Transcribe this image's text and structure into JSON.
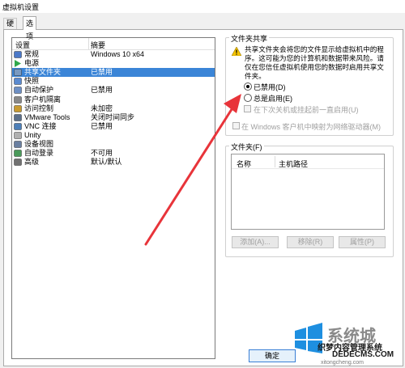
{
  "window": {
    "title": "虚拟机设置"
  },
  "tabs": [
    {
      "label": "硬件",
      "active": false
    },
    {
      "label": "选项",
      "active": true
    }
  ],
  "settings_list": {
    "col_setting": "设置",
    "col_summary": "摘要",
    "items": [
      {
        "name": "常规",
        "summary": "Windows 10 x64",
        "icon": "general-icon",
        "selected": false
      },
      {
        "name": "电源",
        "summary": "",
        "icon": "power-icon",
        "selected": false
      },
      {
        "name": "共享文件夹",
        "summary": "已禁用",
        "icon": "shared-folder-icon",
        "selected": true
      },
      {
        "name": "快照",
        "summary": "",
        "icon": "snapshot-icon",
        "selected": false
      },
      {
        "name": "自动保护",
        "summary": "已禁用",
        "icon": "autoprotect-icon",
        "selected": false
      },
      {
        "name": "客户机隔离",
        "summary": "",
        "icon": "isolation-icon",
        "selected": false
      },
      {
        "name": "访问控制",
        "summary": "未加密",
        "icon": "access-control-icon",
        "selected": false
      },
      {
        "name": "VMware Tools",
        "summary": "关闭时间同步",
        "icon": "vmware-tools-icon",
        "selected": false
      },
      {
        "name": "VNC 连接",
        "summary": "已禁用",
        "icon": "vnc-icon",
        "selected": false
      },
      {
        "name": "Unity",
        "summary": "",
        "icon": "unity-icon",
        "selected": false
      },
      {
        "name": "设备视图",
        "summary": "",
        "icon": "device-view-icon",
        "selected": false
      },
      {
        "name": "自动登录",
        "summary": "不可用",
        "icon": "autologin-icon",
        "selected": false
      },
      {
        "name": "高级",
        "summary": "默认/默认",
        "icon": "advanced-icon",
        "selected": false
      }
    ]
  },
  "folder_sharing": {
    "title": "文件夹共享",
    "warning": "共享文件夹会将您的文件显示给虚拟机中的程序。这可能为您的计算机和数据带来风险。请仅在您信任虚拟机使用您的数据时启用共享文件夹。",
    "option_disabled": "已禁用(D)",
    "option_always": "总是启用(E)",
    "option_until_poweroff": "在下次关机或挂起前一直启用(U)",
    "map_network_drive": "在 Windows 客户机中映射为网络驱动器(M)"
  },
  "folders": {
    "title": "文件夹(F)",
    "col_name": "名称",
    "col_host_path": "主机路径",
    "add_button": "添加(A)...",
    "remove_button": "移除(R)",
    "properties_button": "属性(P)"
  },
  "footer": {
    "ok_button": "确定"
  },
  "watermark": {
    "text": "系统城",
    "site": "织梦内容管理系统",
    "url": "DEDECMS.COM",
    "domain": "xitongcheng.com"
  },
  "colors": {
    "selection": "#3b85d7",
    "annotation_arrow": "#e8343a"
  }
}
